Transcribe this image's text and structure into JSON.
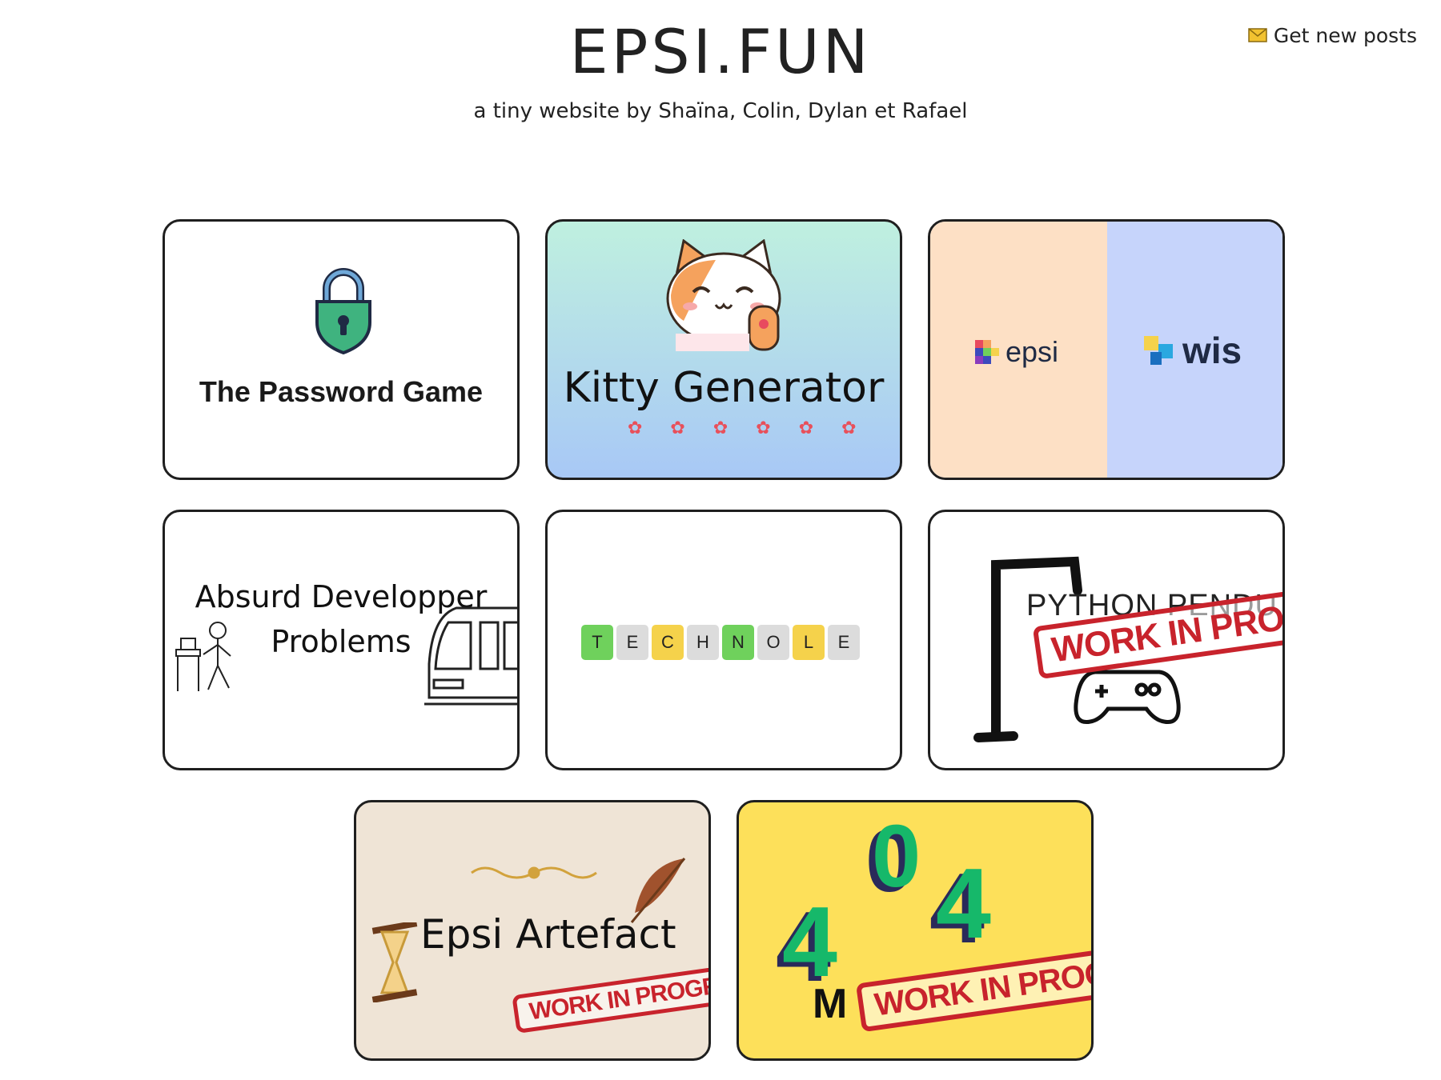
{
  "header": {
    "title": "EPSI.FUN",
    "tagline": "a tiny website by Shaïna, Colin, Dylan et Rafael",
    "subscribe_label": "Get new posts"
  },
  "cards": [
    {
      "title": "The Password Game"
    },
    {
      "title": "Kitty Generator"
    },
    {
      "left_label": "epsi",
      "right_label": "wis",
      "left_bg": "#fde0c5",
      "right_bg": "#c6d4fb"
    },
    {
      "title_line1": "Absurd Developper",
      "title_line2": "Problems"
    },
    {
      "tiles": [
        "T",
        "E",
        "C",
        "H",
        "N",
        "O",
        "L",
        "E"
      ],
      "tile_colors": [
        "#6fd15c",
        "#dcdcdc",
        "#f5d24b",
        "#dcdcdc",
        "#6fd15c",
        "#dcdcdc",
        "#f5d24b",
        "#dcdcdc"
      ]
    },
    {
      "title": "PYTHON PENDU",
      "stamp": "WORK IN PROGRESS"
    },
    {
      "title": "Epsi Artefact",
      "stamp": "WORK IN PROGRESS",
      "bg": "#efe4d6"
    },
    {
      "digits": [
        "4",
        "0",
        "4"
      ],
      "sub": "M",
      "stamp": "WORK IN PROGRESS",
      "bg": "#fde05a"
    }
  ],
  "colors": {
    "border": "#1f1f1f",
    "stamp_red": "#c8232c",
    "lock_green": "#3fb37f"
  }
}
